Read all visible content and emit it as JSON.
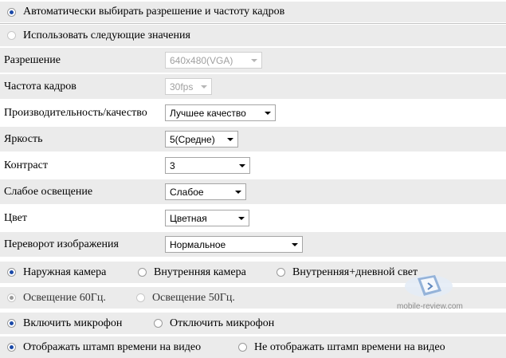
{
  "auto_mode": {
    "label": "Автоматически выбирать разрешение и частоту кадров",
    "selected": true
  },
  "manual_mode": {
    "label": "Использовать следующие значения",
    "selected": false
  },
  "settings": {
    "resolution": {
      "label": "Разрешение",
      "value": "640x480(VGA)",
      "disabled": true
    },
    "frame_rate": {
      "label": "Частота кадров",
      "value": "30fps",
      "disabled": true
    },
    "performance": {
      "label": "Производительность/качество",
      "value": "Лучшее качество"
    },
    "brightness": {
      "label": "Яркость",
      "value": "5(Средне)"
    },
    "contrast": {
      "label": "Контраст",
      "value": "3"
    },
    "low_light": {
      "label": "Слабое освещение",
      "value": "Слабое"
    },
    "color": {
      "label": "Цвет",
      "value": "Цветная"
    },
    "flip": {
      "label": "Переворот изображения",
      "value": "Нормальное"
    }
  },
  "camera_type": {
    "outdoor": {
      "label": "Наружная камера",
      "selected": true
    },
    "indoor": {
      "label": "Внутренняя камера",
      "selected": false
    },
    "indoor_daylight": {
      "label": "Внутренняя+дневной свет",
      "selected": false
    }
  },
  "lighting": {
    "hz60": {
      "label": "Освещение 60Гц.",
      "selected": true
    },
    "hz50": {
      "label": "Освещение 50Гц.",
      "selected": false
    }
  },
  "microphone": {
    "on": {
      "label": "Включить микрофон",
      "selected": true
    },
    "off": {
      "label": "Отключить микрофон",
      "selected": false
    }
  },
  "timestamp": {
    "show": {
      "label": "Отображать штамп времени на видео",
      "selected": true
    },
    "hide": {
      "label": "Не отображать штамп времени на видео",
      "selected": false
    }
  },
  "watermark": {
    "text": "mobile-review.com"
  },
  "colors": {
    "row_shade": "#ebebeb",
    "radio_dot": "#1a49a8"
  }
}
